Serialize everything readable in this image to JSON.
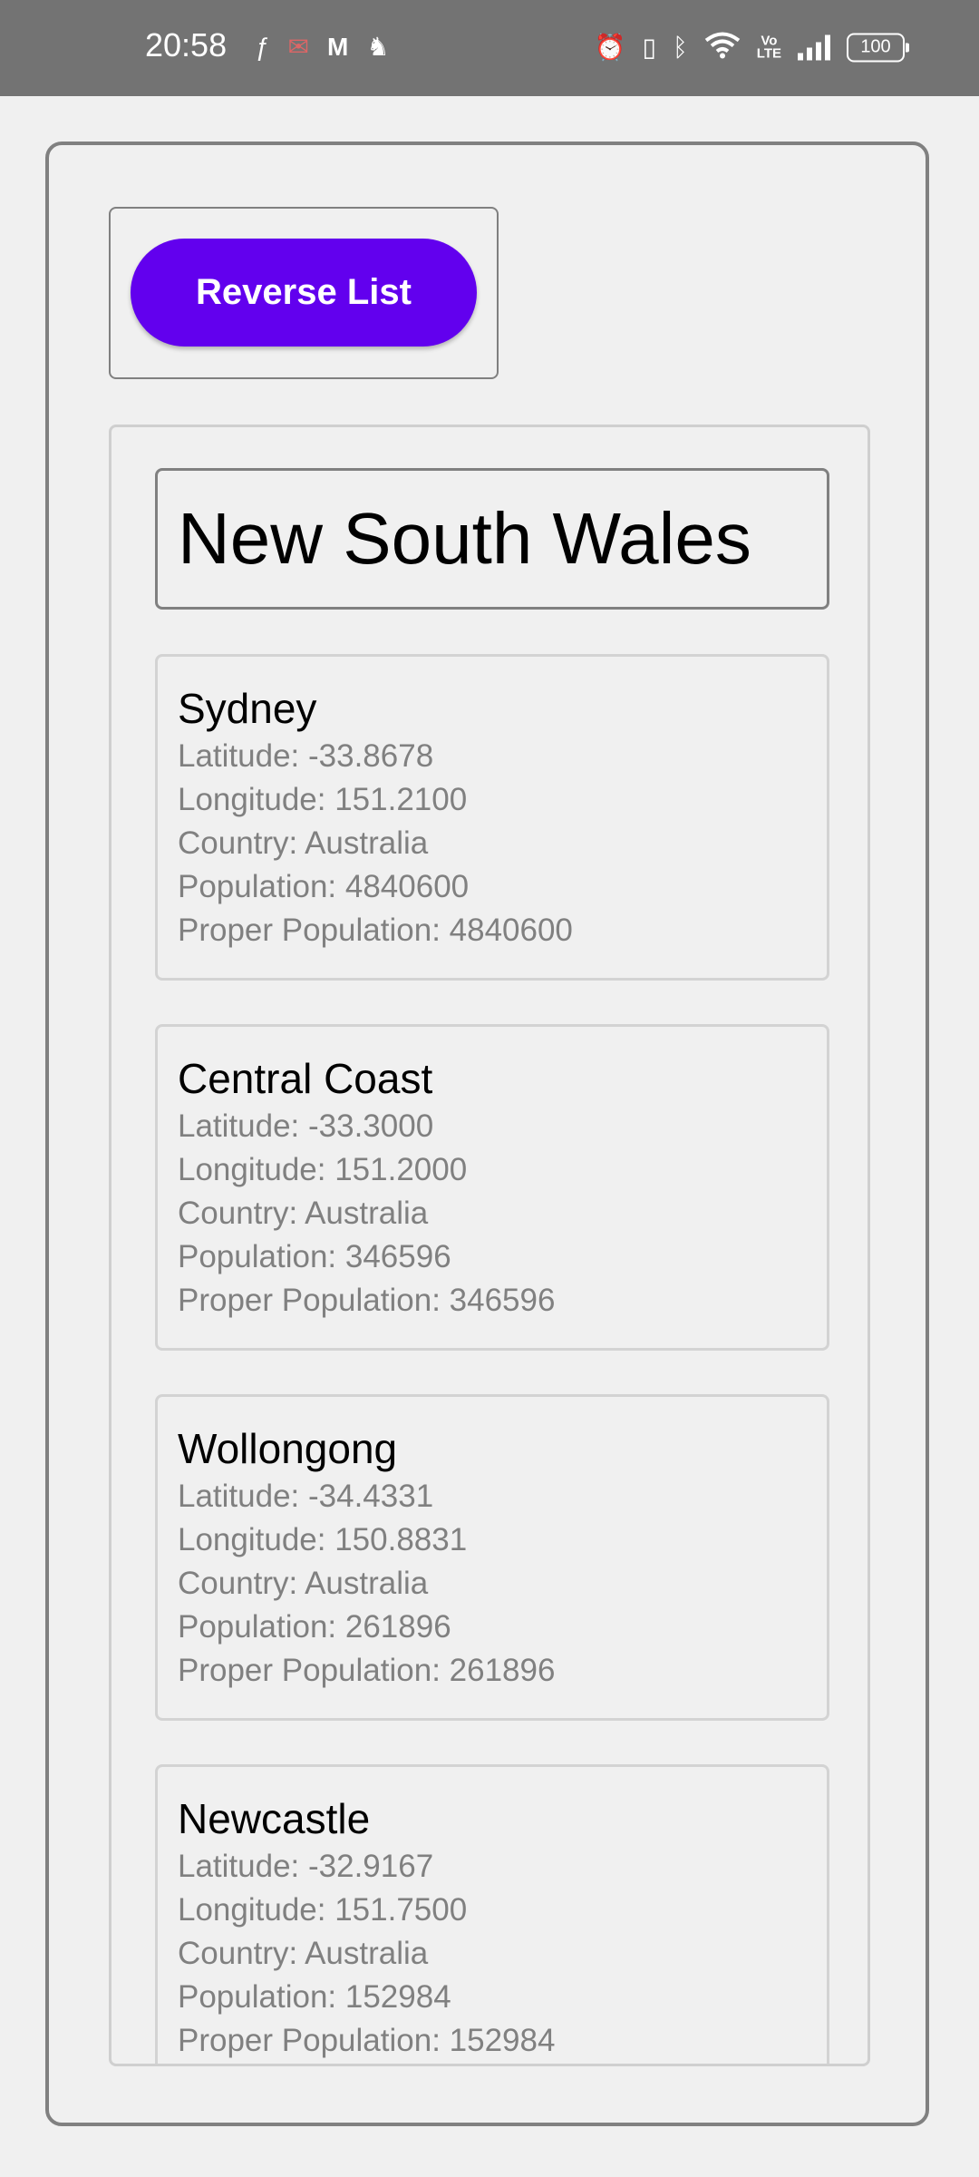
{
  "status_bar": {
    "time": "20:58",
    "left_icons": [
      "facebook-icon",
      "mail-icon",
      "m-app-icon",
      "bird-icon"
    ],
    "right_icons": [
      "alarm-icon",
      "vibrate-icon",
      "bluetooth-icon",
      "wifi-icon",
      "volte-icon",
      "signal-icon"
    ],
    "volte_text": "Vo\nLTE",
    "battery": "100"
  },
  "toolbar": {
    "reverse_label": "Reverse List",
    "button_color": "#6200ee"
  },
  "state": {
    "title": "New South Wales"
  },
  "cities": [
    {
      "name": "Sydney",
      "latitude": "Latitude: -33.8678",
      "longitude": "Longitude: 151.2100",
      "country": "Country: Australia",
      "population": "Population: 4840600",
      "proper_population": "Proper Population: 4840600"
    },
    {
      "name": "Central Coast",
      "latitude": "Latitude: -33.3000",
      "longitude": "Longitude: 151.2000",
      "country": "Country: Australia",
      "population": "Population: 346596",
      "proper_population": "Proper Population: 346596"
    },
    {
      "name": "Wollongong",
      "latitude": "Latitude: -34.4331",
      "longitude": "Longitude: 150.8831",
      "country": "Country: Australia",
      "population": "Population: 261896",
      "proper_population": "Proper Population: 261896"
    },
    {
      "name": "Newcastle",
      "latitude": "Latitude: -32.9167",
      "longitude": "Longitude: 151.7500",
      "country": "Country: Australia",
      "population": "Population: 152984",
      "proper_population": "Proper Population: 152984"
    }
  ]
}
